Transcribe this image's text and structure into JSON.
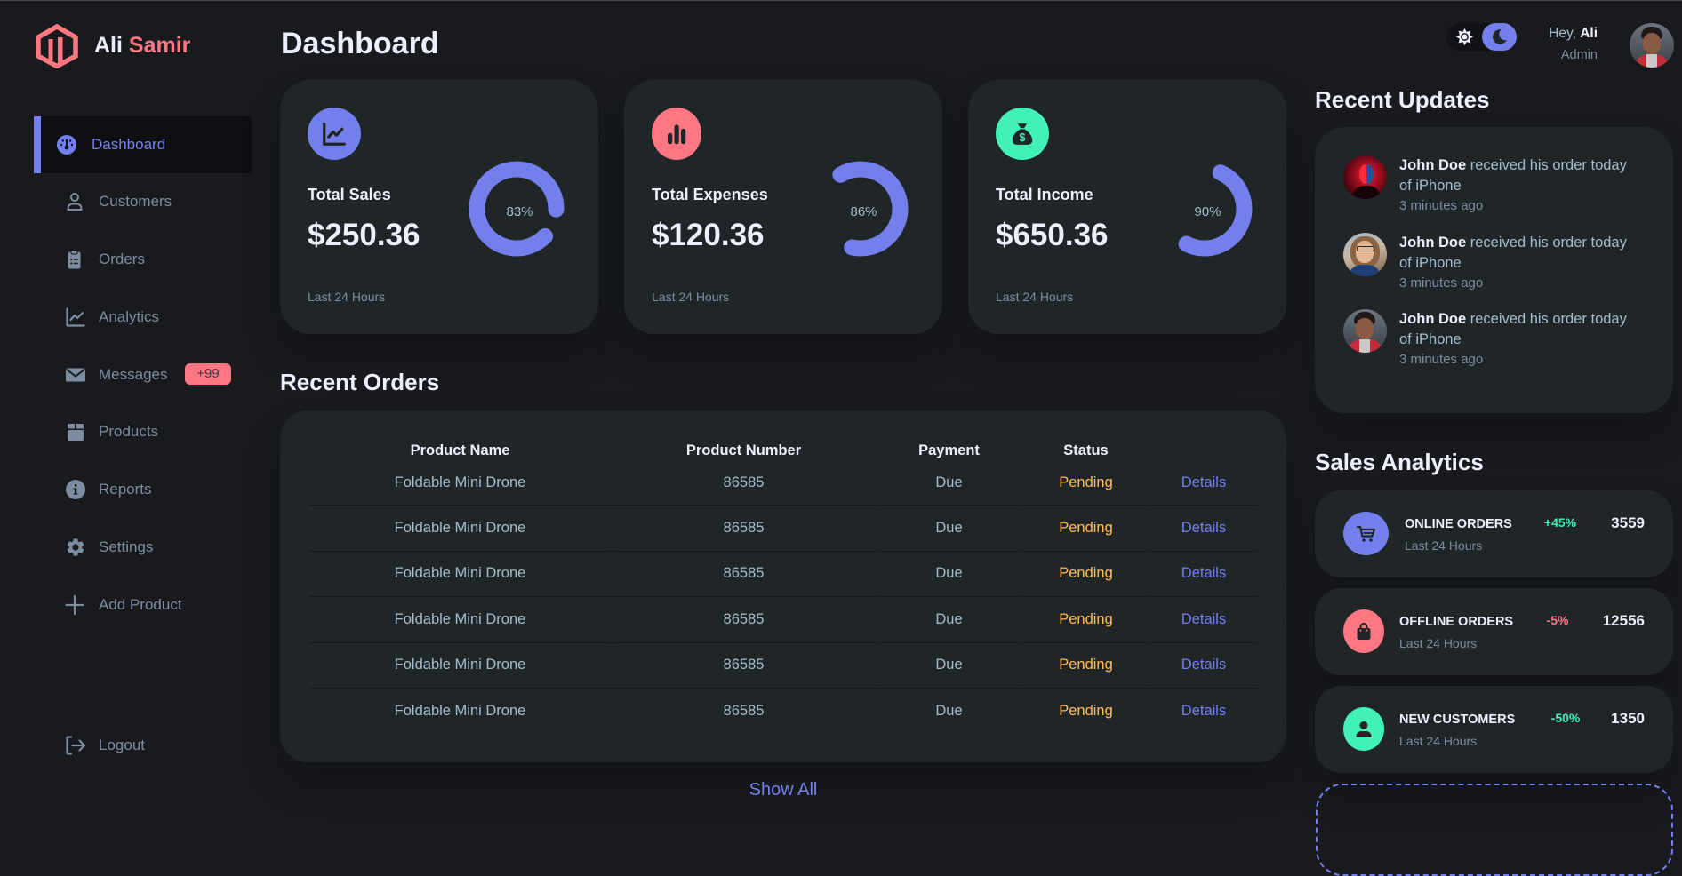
{
  "brand": {
    "first": "Ali",
    "last": "Samir"
  },
  "sidebar": {
    "items": [
      {
        "label": "Dashboard",
        "icon": "dashboard-icon",
        "active": true
      },
      {
        "label": "Customers",
        "icon": "person-outline-icon",
        "active": false
      },
      {
        "label": "Orders",
        "icon": "clipboard-list-icon",
        "active": false
      },
      {
        "label": "Analytics",
        "icon": "line-chart-icon",
        "active": false
      },
      {
        "label": "Messages",
        "icon": "envelope-icon",
        "active": false,
        "badge": "+99"
      },
      {
        "label": "Products",
        "icon": "box-icon",
        "active": false
      },
      {
        "label": "Reports",
        "icon": "info-icon",
        "active": false
      },
      {
        "label": "Settings",
        "icon": "gear-icon",
        "active": false
      },
      {
        "label": "Add Product",
        "icon": "plus-icon",
        "active": false
      }
    ],
    "logout": {
      "label": "Logout",
      "icon": "logout-icon"
    }
  },
  "header": {
    "title": "Dashboard"
  },
  "topbar": {
    "theme_toggle": {
      "options": [
        "light",
        "dark"
      ],
      "active": "dark"
    },
    "greeting": "Hey, ",
    "user_name": "Ali",
    "role": "Admin"
  },
  "insights": [
    {
      "title": "Total Sales",
      "amount": "$250.36",
      "percent_label": "83%",
      "ring_fill": 0.88,
      "period": "Last 24 Hours",
      "icon": "line-chart-icon",
      "color": "#7380ec"
    },
    {
      "title": "Total Expenses",
      "amount": "$120.36",
      "percent_label": "86%",
      "ring_fill": 0.62,
      "period": "Last 24 Hours",
      "icon": "bar-chart-icon",
      "color": "#ff7782"
    },
    {
      "title": "Total Income",
      "amount": "$650.36",
      "percent_label": "90%",
      "ring_fill": 0.51,
      "period": "Last 24 Hours",
      "icon": "money-bag-icon",
      "color": "#41f1b6"
    }
  ],
  "recent_orders": {
    "title": "Recent Orders",
    "columns": [
      "Product Name",
      "Product Number",
      "Payment",
      "Status",
      ""
    ],
    "rows": [
      {
        "name": "Foldable Mini Drone",
        "number": "86585",
        "payment": "Due",
        "status": "Pending",
        "action": "Details"
      },
      {
        "name": "Foldable Mini Drone",
        "number": "86585",
        "payment": "Due",
        "status": "Pending",
        "action": "Details"
      },
      {
        "name": "Foldable Mini Drone",
        "number": "86585",
        "payment": "Due",
        "status": "Pending",
        "action": "Details"
      },
      {
        "name": "Foldable Mini Drone",
        "number": "86585",
        "payment": "Due",
        "status": "Pending",
        "action": "Details"
      },
      {
        "name": "Foldable Mini Drone",
        "number": "86585",
        "payment": "Due",
        "status": "Pending",
        "action": "Details"
      },
      {
        "name": "Foldable Mini Drone",
        "number": "86585",
        "payment": "Due",
        "status": "Pending",
        "action": "Details"
      }
    ],
    "show_all": "Show All"
  },
  "recent_updates": {
    "title": "Recent Updates",
    "items": [
      {
        "name": "John Doe",
        "message": " received his order today of iPhone",
        "time": "3 minutes ago"
      },
      {
        "name": "John Doe",
        "message": " received his order today of iPhone",
        "time": "3 minutes ago"
      },
      {
        "name": "John Doe",
        "message": " received his order today of iPhone",
        "time": "3 minutes ago"
      }
    ]
  },
  "sales_analytics": {
    "title": "Sales Analytics",
    "items": [
      {
        "title": "ONLINE ORDERS",
        "period": "Last 24 Hours",
        "change": "+45%",
        "change_color": "#41f1b6",
        "value": "3559",
        "icon": "cart-icon",
        "color": "#7380ec"
      },
      {
        "title": "OFFLINE ORDERS",
        "period": "Last 24 Hours",
        "change": "-5%",
        "change_color": "#ff7782",
        "value": "12556",
        "icon": "shopping-bag-icon",
        "color": "#ff7782"
      },
      {
        "title": "NEW CUSTOMERS",
        "period": "Last 24 Hours",
        "change": "-50%",
        "change_color": "#41f1b6",
        "value": "1350",
        "icon": "person-icon",
        "color": "#41f1b6"
      }
    ]
  },
  "theme": {
    "primary": "#7380ec",
    "danger": "#ff7782",
    "success": "#41f1b6",
    "warning": "#ffbb55",
    "background": "#181a1e",
    "card": "#202528"
  }
}
